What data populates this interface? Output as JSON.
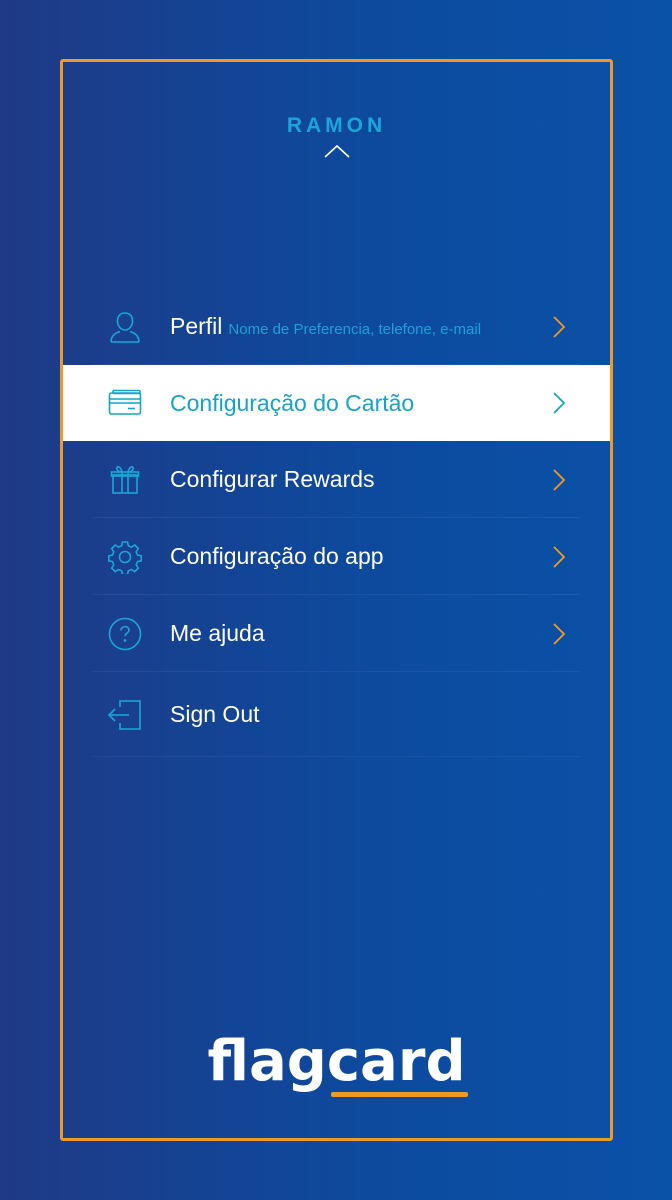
{
  "user": {
    "name": "RAMON"
  },
  "menu": {
    "items": [
      {
        "label": "Perfil",
        "sublabel": "Nome de Preferencia, telefone, e-mail",
        "icon": "user-icon"
      },
      {
        "label": "Configuração do Cartão",
        "icon": "credit-card-icon",
        "active": true
      },
      {
        "label": "Configurar Rewards",
        "icon": "gift-icon"
      },
      {
        "label": "Configuração do app",
        "icon": "gear-icon"
      },
      {
        "label": "Me ajuda",
        "icon": "help-icon"
      },
      {
        "label": "Sign Out",
        "icon": "sign-out-icon"
      }
    ]
  },
  "brand": {
    "logo_text": "flagcard"
  },
  "colors": {
    "accent_orange": "#f09a24",
    "accent_cyan": "#1aa6d9",
    "background": "#0d4a9e",
    "active_bg": "#ffffff"
  }
}
